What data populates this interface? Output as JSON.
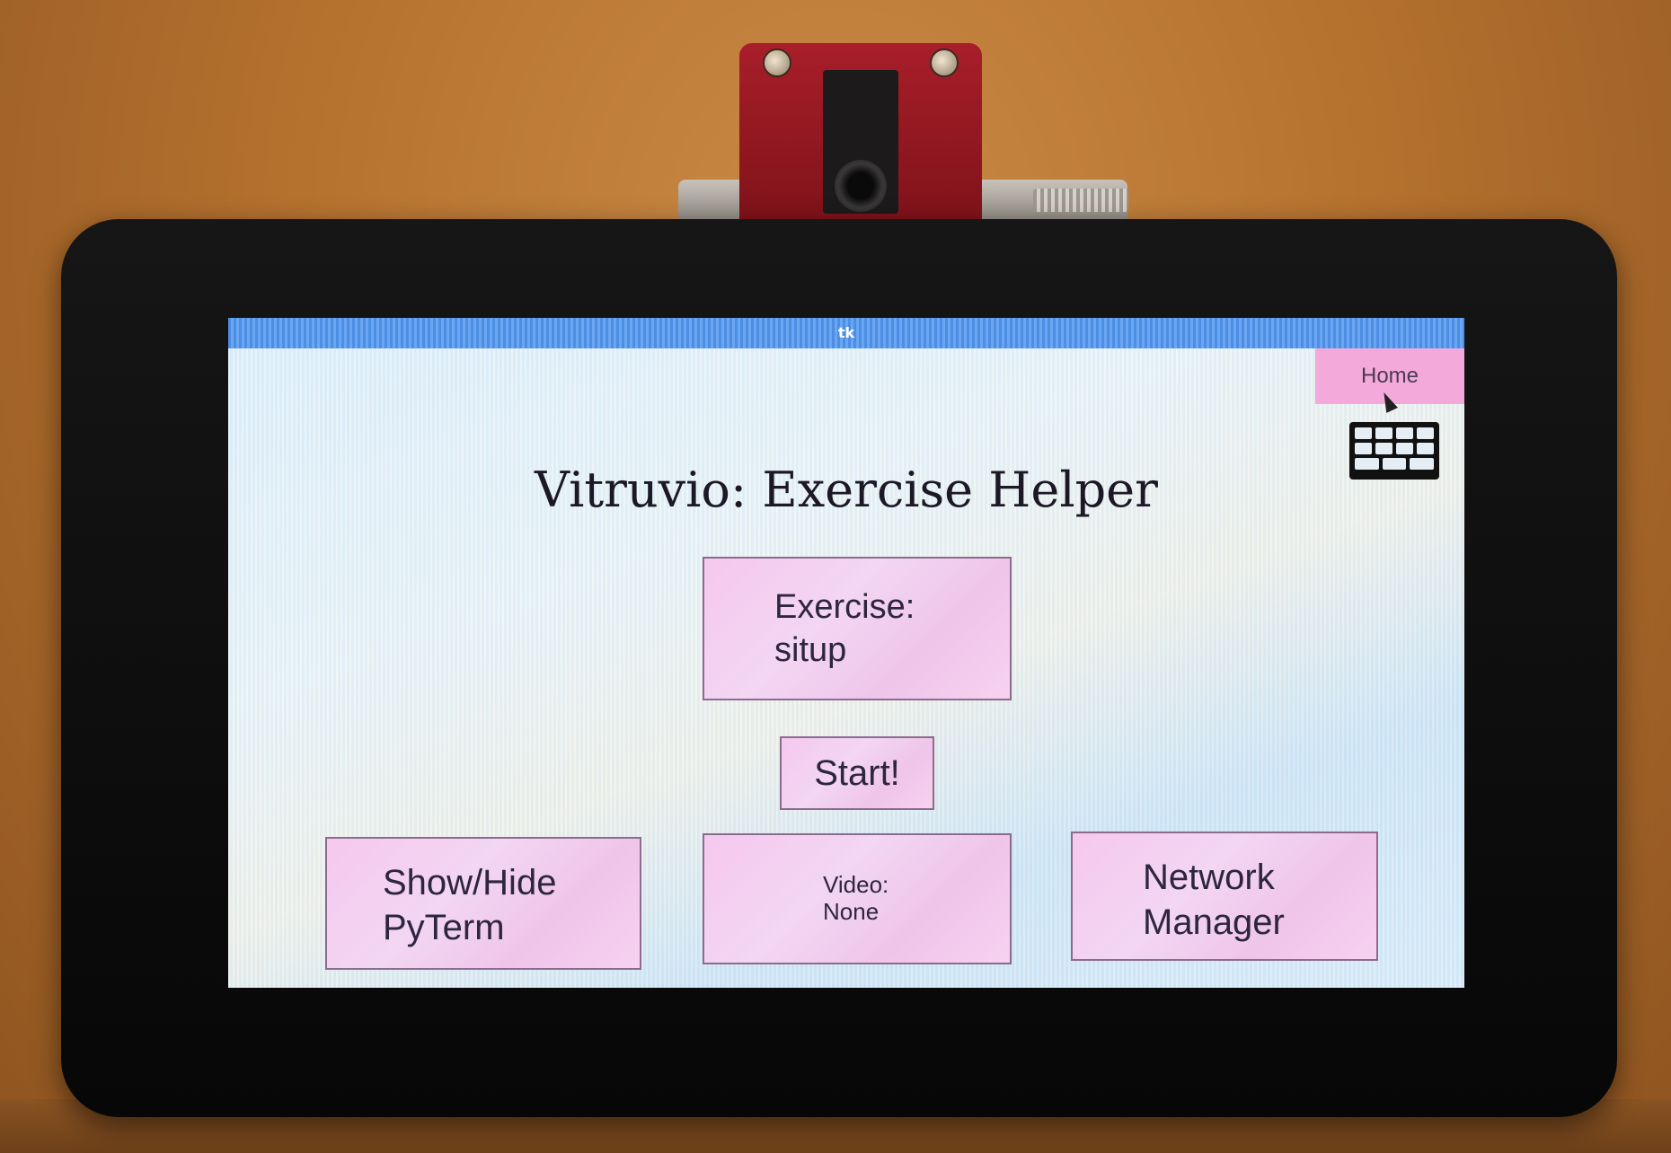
{
  "window": {
    "title": "tk"
  },
  "toolbar": {
    "home_label": "Home",
    "keyboard_icon": "keyboard-icon"
  },
  "main": {
    "title": "Vitruvio: Exercise Helper",
    "exercise": {
      "label": "Exercise:",
      "value": "situp"
    },
    "start_label": "Start!",
    "pyterm": {
      "line1": "Show/Hide",
      "line2": "PyTerm"
    },
    "video": {
      "label": "Video:",
      "value": "None"
    },
    "network": {
      "line1": "Network",
      "line2": "Manager"
    }
  },
  "colors": {
    "titlebar": "#5b9bec",
    "button_pink": "#f2d0f0",
    "home_pink": "#f4a9db",
    "screen_bg": "#dff0fb"
  }
}
